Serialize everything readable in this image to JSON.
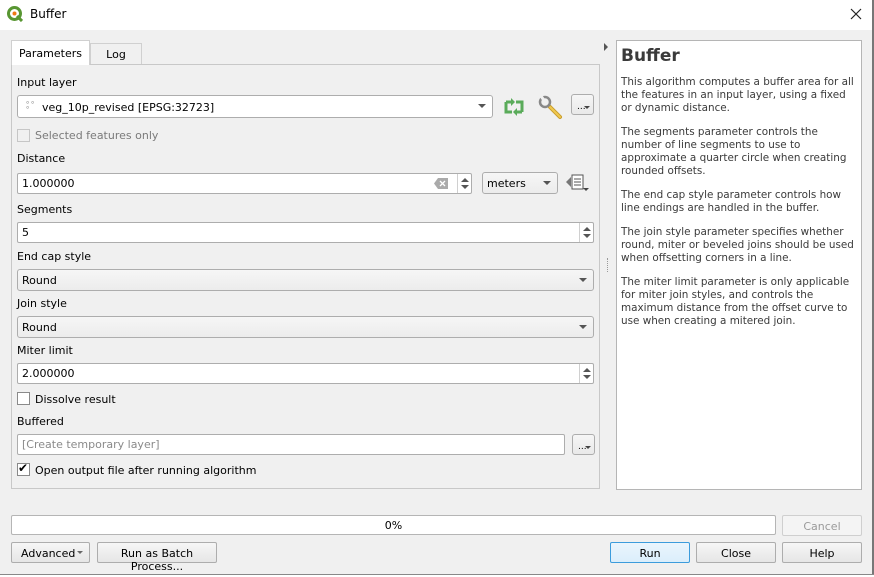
{
  "window": {
    "title": "Buffer",
    "close_label": "Close window"
  },
  "tabs": [
    {
      "label": "Parameters",
      "active": true
    },
    {
      "label": "Log",
      "active": false
    }
  ],
  "params": {
    "input_layer": {
      "label": "Input layer",
      "value": "veg_10p_revised [EPSG:32723]",
      "selected_only_label": "Selected features only",
      "selected_only_checked": false,
      "selected_only_enabled": false
    },
    "distance": {
      "label": "Distance",
      "value": "1.000000",
      "unit": "meters"
    },
    "segments": {
      "label": "Segments",
      "value": "5"
    },
    "end_cap_style": {
      "label": "End cap style",
      "value": "Round"
    },
    "join_style": {
      "label": "Join style",
      "value": "Round"
    },
    "miter_limit": {
      "label": "Miter limit",
      "value": "2.000000"
    },
    "dissolve": {
      "label": "Dissolve result",
      "checked": false
    },
    "buffered": {
      "label": "Buffered",
      "placeholder": "[Create temporary layer]",
      "value": ""
    },
    "open_output": {
      "label": "Open output file after running algorithm",
      "checked": true
    },
    "browse_label": "..."
  },
  "help": {
    "title": "Buffer",
    "paragraphs": [
      "This algorithm computes a buffer area for all the features in an input layer, using a fixed or dynamic distance.",
      "The segments parameter controls the number of line segments to use to approximate a quarter circle when creating rounded offsets.",
      "The end cap style parameter controls how line endings are handled in the buffer.",
      "The join style parameter specifies whether round, miter or beveled joins should be used when offsetting corners in a line.",
      "The miter limit parameter is only applicable for miter join styles, and controls the maximum distance from the offset curve to use when creating a mitered join."
    ]
  },
  "progress": {
    "value": 0,
    "label": "0%"
  },
  "buttons": {
    "cancel": "Cancel",
    "advanced": "Advanced",
    "batch": "Run as Batch Process...",
    "run": "Run",
    "close": "Close",
    "help": "Help"
  },
  "colors": {
    "iterate_icon": "#5aab5a",
    "default_button_border": "#3c9cdc"
  }
}
